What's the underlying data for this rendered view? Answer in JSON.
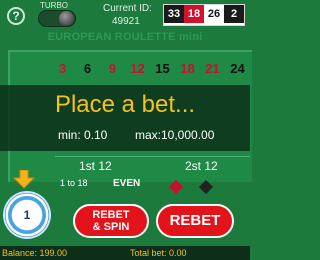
{
  "header": {
    "help_label": "?",
    "turbo_label": "TURBO",
    "current_id_label": "Current ID:",
    "current_id_value": "49921",
    "recent_results": [
      {
        "value": "33",
        "color": "black"
      },
      {
        "value": "18",
        "color": "red"
      },
      {
        "value": "26",
        "color": "white"
      },
      {
        "value": "2",
        "color": "black"
      }
    ]
  },
  "title": "EUROPEAN ROULETTE mini",
  "table": {
    "numbers": [
      {
        "value": "3",
        "color": "red"
      },
      {
        "value": "6",
        "color": "black"
      },
      {
        "value": "9",
        "color": "red"
      },
      {
        "value": "12",
        "color": "red"
      },
      {
        "value": "15",
        "color": "black"
      },
      {
        "value": "18",
        "color": "red"
      },
      {
        "value": "21",
        "color": "red"
      },
      {
        "value": "24",
        "color": "black"
      }
    ],
    "dozens": [
      "1st 12",
      "2st 12"
    ],
    "outside": {
      "low": "1 to 18",
      "even": "EVEN"
    }
  },
  "overlay": {
    "title": "Place a bet...",
    "min": "min: 0.10",
    "max": "max:10,000.00"
  },
  "chip": {
    "value": "1"
  },
  "buttons": {
    "rebet_spin_line1": "REBET",
    "rebet_spin_line2": "& SPIN",
    "rebet": "REBET"
  },
  "footer": {
    "balance": "Balance: 199.00",
    "total_bet": "Total bet: 0.00"
  },
  "icons": {
    "help": "help-icon",
    "arrow": "arrow-down-icon",
    "red_bet": "red-diamond-icon",
    "black_bet": "black-diamond-icon"
  },
  "colors": {
    "background": "#1c7a3c",
    "accent": "#f4c21b",
    "button": "#e3131b"
  }
}
